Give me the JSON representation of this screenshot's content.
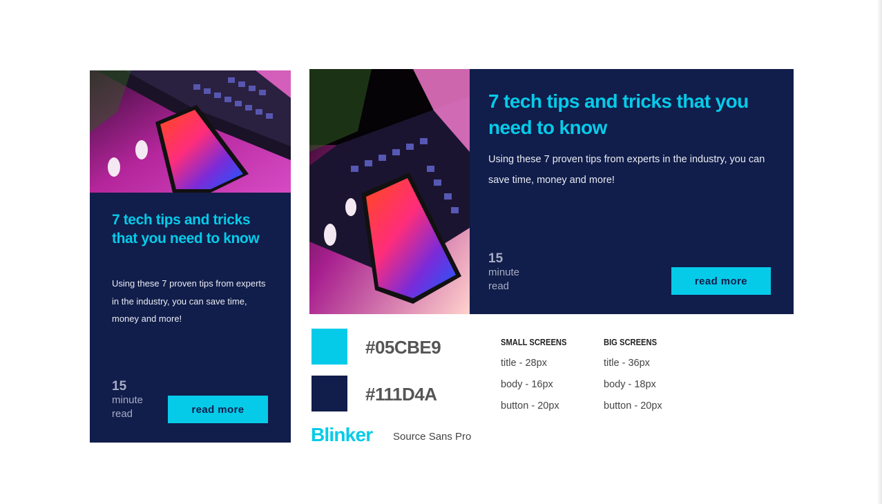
{
  "colors": {
    "accent": "#05CBE9",
    "navy": "#111D4A",
    "text_gray": "#a7adc4"
  },
  "card_small": {
    "image": "laptop-phone-photo",
    "title": "7 tech tips and tricks that you need to know",
    "body": "Using these 7 proven tips from experts in the industry, you can save time, money and more!",
    "read_time_number": "15",
    "read_time_unit": "minute read",
    "button_label": "read more"
  },
  "card_large": {
    "image": "laptop-phone-photo",
    "title": "7 tech tips and tricks that you need to know",
    "body": "Using these 7 proven tips from experts in the industry, you can save time, money and more!",
    "read_time_number": "15",
    "read_time_unit": "minute read",
    "button_label": "read more"
  },
  "style_guide": {
    "swatches": [
      {
        "hex": "#05CBE9",
        "label": "#05CBE9"
      },
      {
        "hex": "#111D4A",
        "label": "#111D4A"
      }
    ],
    "fonts": {
      "primary": "Blinker",
      "secondary": "Source Sans Pro"
    },
    "small_screens": {
      "heading": "SMALL SCREENS",
      "lines": [
        "title - 28px",
        "body - 16px",
        "button - 20px"
      ]
    },
    "big_screens": {
      "heading": "BIG SCREENS",
      "lines": [
        "title - 36px",
        "body - 18px",
        "button - 20px"
      ]
    }
  }
}
